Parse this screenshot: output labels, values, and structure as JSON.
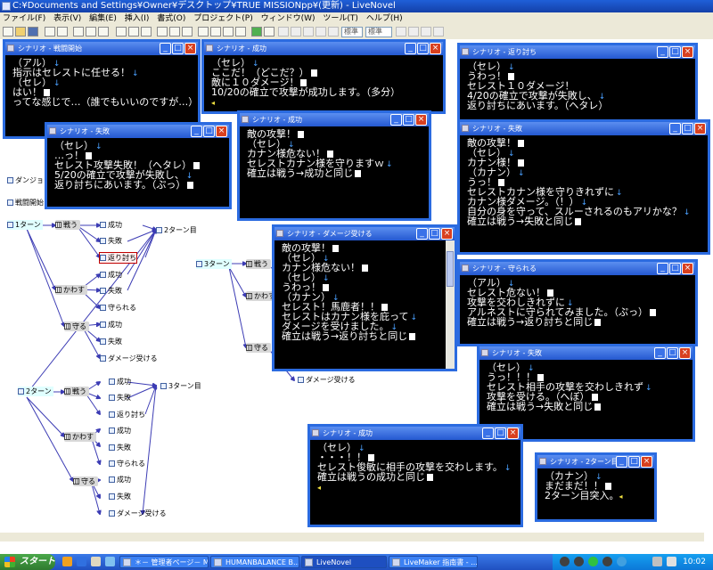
{
  "app": {
    "title": "C:¥Documents and Settings¥Owner¥デスクトップ¥TRUE MISSIONpp¥(更新) - LiveNovel",
    "menu": [
      "ファイル(F)",
      "表示(V)",
      "編集(E)",
      "挿入(I)",
      "書式(O)",
      "プロジェクト(P)",
      "ウィンドウ(W)",
      "ツール(T)",
      "ヘルプ(H)"
    ],
    "toolbar_selects": [
      "標準",
      "標準"
    ]
  },
  "nodes": [
    {
      "label": "ダンジョン",
      "style": "plain"
    },
    {
      "label": "戦闘開始",
      "style": "plain"
    },
    {
      "label": "1ターン",
      "style": "cyan"
    },
    {
      "label": "戦う",
      "style": "grid"
    },
    {
      "label": "成功",
      "style": "plain"
    },
    {
      "label": "失敗",
      "style": "plain"
    },
    {
      "label": "返り討ち",
      "style": "sel"
    },
    {
      "label": "2ターン目",
      "style": "plain"
    },
    {
      "label": "かわす",
      "style": "grid"
    },
    {
      "label": "成功",
      "style": "plain"
    },
    {
      "label": "失敗",
      "style": "plain"
    },
    {
      "label": "守られる",
      "style": "plain"
    },
    {
      "label": "守る",
      "style": "grid"
    },
    {
      "label": "成功",
      "style": "plain"
    },
    {
      "label": "失敗",
      "style": "plain"
    },
    {
      "label": "ダメージ受ける",
      "style": "plain"
    },
    {
      "label": "2ターン",
      "style": "cyan"
    },
    {
      "label": "戦う",
      "style": "grid"
    },
    {
      "label": "成功",
      "style": "plain"
    },
    {
      "label": "失敗",
      "style": "plain"
    },
    {
      "label": "返り討ち",
      "style": "plain"
    },
    {
      "label": "3ターン目",
      "style": "plain"
    },
    {
      "label": "かわす",
      "style": "grid"
    },
    {
      "label": "成功",
      "style": "plain"
    },
    {
      "label": "失敗",
      "style": "plain"
    },
    {
      "label": "守られる",
      "style": "plain"
    },
    {
      "label": "守る",
      "style": "grid"
    },
    {
      "label": "成功",
      "style": "plain"
    },
    {
      "label": "失敗",
      "style": "plain"
    },
    {
      "label": "ダメージ受ける",
      "style": "plain"
    },
    {
      "label": "3ターン",
      "style": "cyan"
    },
    {
      "label": "戦う",
      "style": "grid"
    },
    {
      "label": "かわす",
      "style": "grid"
    },
    {
      "label": "守る",
      "style": "grid"
    },
    {
      "label": "ダメージ受ける",
      "style": "plain"
    }
  ],
  "windows": [
    {
      "title": "シナリオ - 戦闘開始",
      "lines": [
        [
          {
            "t": "（アル）"
          },
          {
            "a": 1
          }
        ],
        [
          {
            "t": "指示はセレストに任せる！"
          },
          {
            "a": 1
          }
        ],
        [
          {
            "t": "（セレ）"
          },
          {
            "a": 1
          }
        ],
        [
          {
            "t": "はい！"
          },
          {
            "m": 1
          }
        ],
        [
          {
            "t": "ってな感じで…（誰でもいいのですが…）"
          }
        ]
      ]
    },
    {
      "title": "シナリオ - 成功",
      "lines": [
        [
          {
            "t": "（セレ）"
          },
          {
            "a": 1
          }
        ],
        [
          {
            "t": "ここだ！（どこだ？）"
          },
          {
            "m": 1
          }
        ],
        [
          {
            "t": "敵に１０ダメージ！"
          },
          {
            "m": 1
          }
        ],
        [
          {
            "t": "10/20の確立で攻撃が成功します。（多分）"
          }
        ],
        [
          {
            "c": 1
          }
        ]
      ]
    },
    {
      "title": "シナリオ - 返り討ち",
      "lines": [
        [
          {
            "t": "（セレ）"
          },
          {
            "a": 1
          }
        ],
        [
          {
            "t": "うわっ！"
          },
          {
            "m": 1
          }
        ],
        [
          {
            "t": "セレスト１０ダメージ！"
          }
        ],
        [
          {
            "t": "4/20の確立で攻撃が失敗し、"
          },
          {
            "a": 1
          }
        ],
        [
          {
            "t": "返り討ちにあいます。（ヘタレ）"
          }
        ]
      ]
    },
    {
      "title": "シナリオ - 失敗",
      "lines": [
        [
          {
            "t": "（セレ）"
          },
          {
            "a": 1
          }
        ],
        [
          {
            "t": "…っ！"
          },
          {
            "m": 1
          }
        ],
        [
          {
            "t": "セレスト攻撃失敗！（ヘタレ）"
          },
          {
            "m": 1
          }
        ],
        [
          {
            "t": "5/20の確立で攻撃が失敗し、"
          },
          {
            "a": 1
          }
        ],
        [
          {
            "t": "返り討ちにあいます。（ぷっ）"
          },
          {
            "m": 1
          }
        ]
      ]
    },
    {
      "title": "シナリオ - 成功",
      "lines": [
        [
          {
            "t": "敵の攻撃！"
          },
          {
            "m": 1
          }
        ],
        [
          {
            "t": "（セレ）"
          },
          {
            "a": 1
          }
        ],
        [
          {
            "t": "カナン様危ない！"
          },
          {
            "m": 1
          }
        ],
        [
          {
            "t": "セレストカナン様を守りますｗ"
          },
          {
            "a": 1
          }
        ],
        [
          {
            "t": "確立は戦う→成功と同じ"
          },
          {
            "m": 1
          }
        ]
      ]
    },
    {
      "title": "シナリオ - 失敗",
      "lines": [
        [
          {
            "t": "敵の攻撃！"
          },
          {
            "m": 1
          }
        ],
        [
          {
            "t": "（セレ）"
          },
          {
            "a": 1
          }
        ],
        [
          {
            "t": "カナン様！"
          },
          {
            "m": 1
          }
        ],
        [
          {
            "t": "（カナン）"
          },
          {
            "a": 1
          }
        ],
        [
          {
            "t": "うっ！"
          },
          {
            "m": 1
          }
        ],
        [
          {
            "t": "セレストカナン様を守りきれずに"
          },
          {
            "a": 1
          }
        ],
        [
          {
            "t": "カナン様ダメージ。（！）"
          },
          {
            "a": 1
          }
        ],
        [
          {
            "t": "自分の身を守って、スルーされるのもアリかな？"
          },
          {
            "a": 1
          }
        ],
        [
          {
            "t": "確立は戦う→失敗と同じ"
          },
          {
            "m": 1
          }
        ]
      ]
    },
    {
      "title": "シナリオ - ダメージ受ける",
      "lines": [
        [
          {
            "t": "敵の攻撃！"
          },
          {
            "m": 1
          }
        ],
        [
          {
            "t": "（セレ）"
          },
          {
            "a": 1
          }
        ],
        [
          {
            "t": "カナン様危ない！"
          },
          {
            "m": 1
          }
        ],
        [
          {
            "t": "（セレ）"
          },
          {
            "a": 1
          }
        ],
        [
          {
            "t": "うわっ！"
          },
          {
            "m": 1
          }
        ],
        [
          {
            "t": "（カナン）"
          },
          {
            "a": 1
          }
        ],
        [
          {
            "t": "セレスト！馬鹿者！！"
          },
          {
            "m": 1
          }
        ],
        [
          {
            "t": "セレストはカナン様を庇って"
          },
          {
            "a": 1
          }
        ],
        [
          {
            "t": "ダメージを受けました。"
          },
          {
            "a": 1
          }
        ],
        [
          {
            "t": "確立は戦う→返り討ちと同じ"
          },
          {
            "m": 1
          }
        ]
      ]
    },
    {
      "title": "シナリオ - 守られる",
      "lines": [
        [
          {
            "t": "（アル）"
          },
          {
            "a": 1
          }
        ],
        [
          {
            "t": "セレスト危ない！"
          },
          {
            "m": 1
          }
        ],
        [
          {
            "t": "攻撃を交わしきれずに"
          },
          {
            "a": 1
          }
        ],
        [
          {
            "t": "アルネストに守られてみました。（ぷっ）"
          },
          {
            "m": 1
          }
        ],
        [
          {
            "t": "確立は戦う→返り討ちと同じ"
          },
          {
            "m": 1
          }
        ]
      ]
    },
    {
      "title": "シナリオ - 失敗",
      "lines": [
        [
          {
            "t": "（セレ）"
          },
          {
            "a": 1
          }
        ],
        [
          {
            "t": "うっ！！！"
          },
          {
            "m": 1
          }
        ],
        [
          {
            "t": "セレスト相手の攻撃を交わしきれず"
          },
          {
            "a": 1
          }
        ],
        [
          {
            "t": "攻撃を受ける。（へぼ）"
          },
          {
            "m": 1
          }
        ],
        [
          {
            "t": "確立は戦う→失敗と同じ"
          },
          {
            "m": 1
          }
        ]
      ]
    },
    {
      "title": "シナリオ - 成功",
      "lines": [
        [
          {
            "t": "（セレ）"
          },
          {
            "a": 1
          }
        ],
        [
          {
            "t": "・・・！！"
          },
          {
            "m": 1
          }
        ],
        [
          {
            "t": "セレスト俊敏に相手の攻撃を交わします。"
          },
          {
            "a": 1
          }
        ],
        [
          {
            "t": "確立は戦うの成功と同じ"
          },
          {
            "m": 1
          }
        ],
        [
          {
            "c": 1
          }
        ]
      ]
    },
    {
      "title": "シナリオ - 2ターン目",
      "lines": [
        [
          {
            "t": "（カナン）"
          },
          {
            "a": 1
          }
        ],
        [
          {
            "t": "まだまだ！！"
          },
          {
            "m": 1
          }
        ],
        [
          {
            "t": "2ターン目突入。"
          },
          {
            "c": 1
          }
        ]
      ]
    }
  ],
  "taskbar": {
    "start": "スタート",
    "tasks": [
      "＊－ 管理者ページ－ M...",
      "HUMANBALANCE B...",
      "LiveNovel",
      "LiveMaker 指南書 - ..."
    ],
    "clock": "10:02"
  }
}
